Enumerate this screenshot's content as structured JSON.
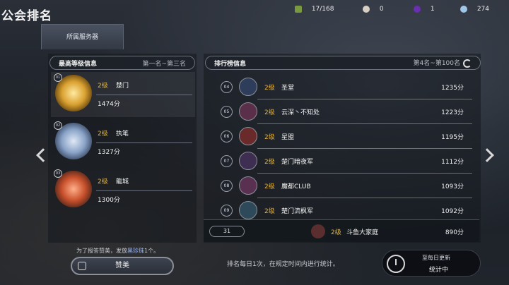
{
  "header": {
    "title": "公会排名",
    "resources": [
      "17/168",
      "0",
      "1",
      "274"
    ]
  },
  "tab": {
    "label": "所属服务器"
  },
  "left_section": {
    "title": "最高等级信息",
    "range": "第一名~第三名"
  },
  "right_section": {
    "title": "排行榜信息",
    "range": "第4名~第100名"
  },
  "top3": [
    {
      "rank": "01",
      "level": "2级",
      "name": "楚门",
      "score": "1474分"
    },
    {
      "rank": "02",
      "level": "2级",
      "name": "执笔",
      "score": "1327分"
    },
    {
      "rank": "03",
      "level": "2级",
      "name": "龍城",
      "score": "1300分"
    }
  ],
  "rankings": [
    {
      "rank": "04",
      "level": "2级",
      "name": "圣堂",
      "score": "1235分"
    },
    {
      "rank": "05",
      "level": "2级",
      "name": "云深丶不知处",
      "score": "1223分"
    },
    {
      "rank": "06",
      "level": "2级",
      "name": "星盟",
      "score": "1195分"
    },
    {
      "rank": "07",
      "level": "2级",
      "name": "楚门暗夜军",
      "score": "1112分"
    },
    {
      "rank": "08",
      "level": "2级",
      "name": "魔都CLUB",
      "score": "1093分"
    },
    {
      "rank": "09",
      "level": "2级",
      "name": "楚门流枫军",
      "score": "1092分"
    }
  ],
  "my_guild": {
    "rank": "31",
    "level": "2级",
    "name": "斗鱼大家庭",
    "score": "890分"
  },
  "praise": {
    "note_pre": "为了报答赞美，发放",
    "note_highlight": "黑珍珠",
    "note_post": "1个。",
    "button": "赞美"
  },
  "footer": {
    "rank_note": "排名每日1次，在规定时间内进行统计。",
    "update_line1": "至每日更新",
    "update_line2": "统计中"
  },
  "colors": {
    "level": "#e6b33a",
    "gold": "#d9a030",
    "silver": "#8aa3c8",
    "bronze": "#c8502c"
  }
}
